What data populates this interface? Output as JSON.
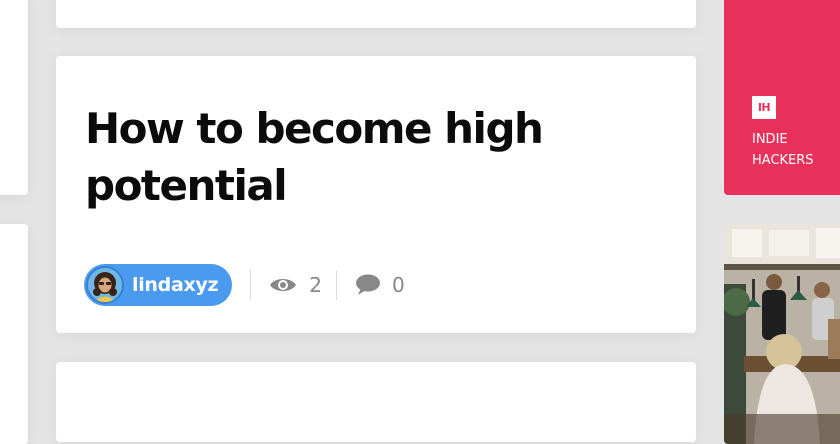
{
  "post": {
    "title": "How to become high potential",
    "author": "lindaxyz",
    "views": "2",
    "comments": "0"
  },
  "sidebar_ad": {
    "logo": "IH",
    "label_line1": "INDIE",
    "label_line2": "HACKERS",
    "bg_color": "#e8315a"
  },
  "icons": {
    "views": "eye-icon",
    "comments": "speech-bubble-icon"
  },
  "colors": {
    "author_chip": "#4a9af0",
    "background": "#e4e4e4"
  }
}
